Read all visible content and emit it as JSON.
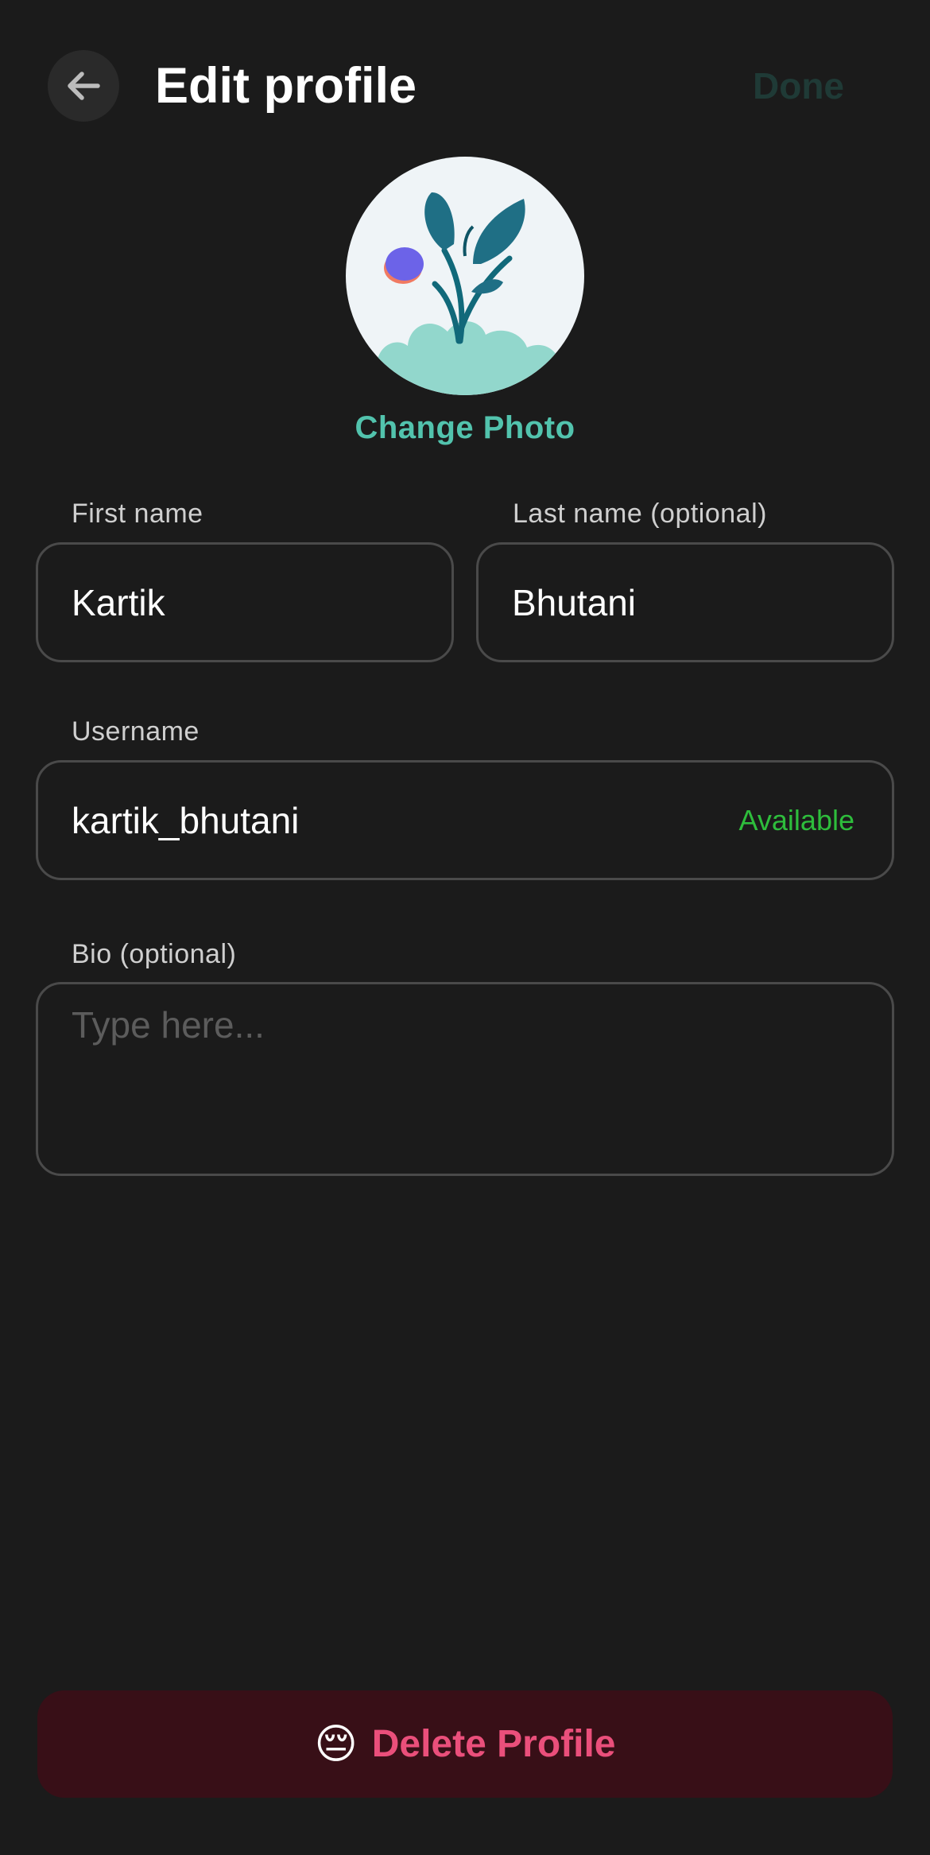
{
  "header": {
    "title": "Edit profile",
    "done_label": "Done",
    "back_icon": "arrow-left-icon"
  },
  "profile_photo": {
    "change_label": "Change Photo",
    "accent_color": "#52c3ad"
  },
  "form": {
    "first_name": {
      "label": "First name",
      "value": "Kartik"
    },
    "last_name": {
      "label": "Last name (optional)",
      "value": "Bhutani"
    },
    "username": {
      "label": "Username",
      "value": "kartik_bhutani",
      "status": "Available",
      "status_color": "#2ebd3c"
    },
    "bio": {
      "label": "Bio (optional)",
      "value": "",
      "placeholder": "Type here..."
    }
  },
  "delete": {
    "emoji": "😔",
    "label": "Delete Profile",
    "color": "#ea4f7b"
  }
}
